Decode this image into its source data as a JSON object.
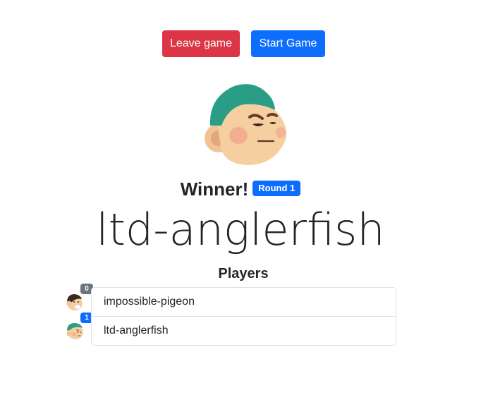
{
  "toolbar": {
    "leave_label": "Leave game",
    "start_label": "Start Game"
  },
  "result": {
    "heading": "Winner!",
    "round_badge": "Round 1",
    "winner_name": "ltd-anglerfish"
  },
  "players": {
    "heading": "Players",
    "items": [
      {
        "name": "impossible-pigeon",
        "score": "0",
        "badge_color": "#6c757d",
        "avatar": "pigeon-avatar-icon"
      },
      {
        "name": "ltd-anglerfish",
        "score": "1",
        "badge_color": "#0d6efd",
        "avatar": "anglerfish-avatar-icon"
      }
    ]
  },
  "colors": {
    "danger": "#dc3545",
    "primary": "#0d6efd",
    "secondary": "#6c757d",
    "avatar_hat": "#2a9d86",
    "avatar_skin": "#f5cfa0"
  }
}
